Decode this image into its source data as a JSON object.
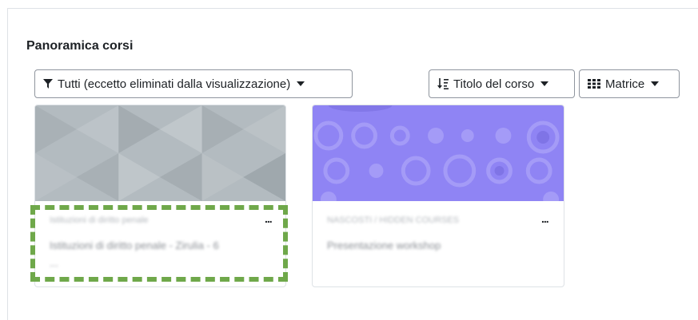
{
  "section": {
    "title": "Panoramica corsi"
  },
  "toolbar": {
    "filter_label": "Tutti (eccetto eliminati dalla visualizzazione)",
    "sort_label": "Titolo del corso",
    "view_label": "Matrice"
  },
  "courses": [
    {
      "category": "Istituzioni di diritto penale",
      "name": "Istituzioni di diritto penale - Zirulia - 6 ...",
      "more_label": "..."
    },
    {
      "category": "NASCOSTI / HIDDEN COURSES",
      "name": "Presentazione workshop",
      "more_label": "..."
    }
  ],
  "colors": {
    "card1_image_bg": "#b3bbc0",
    "card2_image_bg": "#8f84f4",
    "highlight_border": "#6fa84a"
  }
}
